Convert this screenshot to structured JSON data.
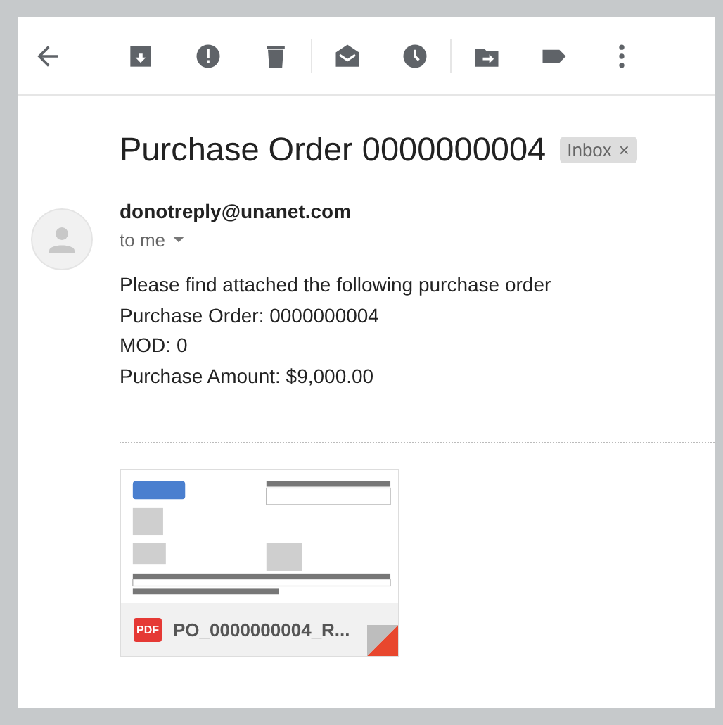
{
  "subject": "Purchase Order 0000000004",
  "labels": [
    {
      "text": "Inbox",
      "close": "×"
    }
  ],
  "message": {
    "sender": "donotreply@unanet.com",
    "recipient": "to me",
    "body": [
      "Please find attached the following purchase order",
      "Purchase Order: 0000000004",
      "MOD: 0",
      "Purchase Amount: $9,000.00"
    ]
  },
  "attachments": [
    {
      "type_label": "PDF",
      "name": "PO_0000000004_R..."
    }
  ]
}
